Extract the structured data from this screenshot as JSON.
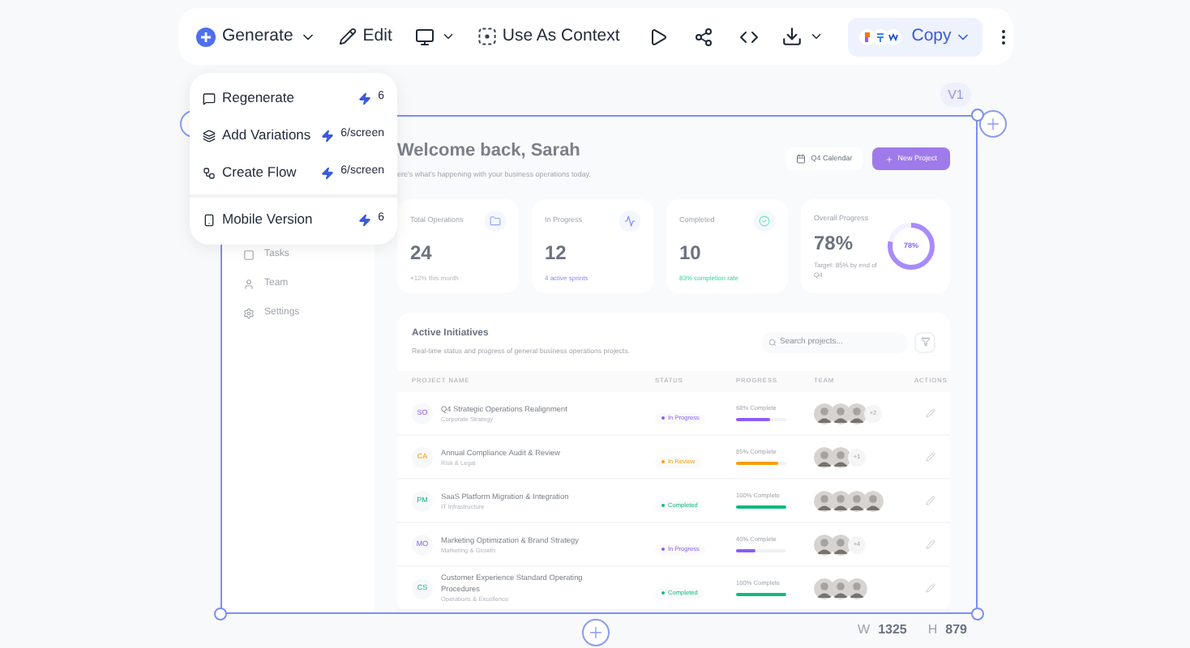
{
  "toolbar": {
    "generate_label": "Generate",
    "edit_label": "Edit",
    "context_label": "Use As Context",
    "copy_label": "Copy"
  },
  "menu": {
    "groups": [
      [
        {
          "label": "Regenerate",
          "cost": "6"
        },
        {
          "label": "Add Variations",
          "cost": "6/screen"
        },
        {
          "label": "Create Flow",
          "cost": "6/screen"
        }
      ],
      [
        {
          "label": "Mobile Version",
          "cost": "6"
        }
      ]
    ]
  },
  "canvas": {
    "version_badge": "V1",
    "width_label": "W",
    "width_value": "1325",
    "height_label": "H",
    "height_value": "879"
  },
  "design": {
    "sidebar": [
      {
        "label": "Tasks"
      },
      {
        "label": "Team"
      },
      {
        "label": "Settings"
      }
    ],
    "title": "Welcome back, Sarah",
    "subtitle": "ere's what's happening with your business operations today.",
    "calendar_button": "Q4 Calendar",
    "new_button": "New Project",
    "stats": [
      {
        "kind": "stat",
        "label": "Total Operations",
        "value": "24",
        "note": "+12% this month"
      },
      {
        "kind": "stat",
        "label": "In Progress",
        "value": "12",
        "note": "4 active sprints"
      },
      {
        "kind": "stat",
        "label": "Completed",
        "value": "10",
        "note": "83% completion rate"
      },
      {
        "kind": "ring",
        "label": "Overall Progress",
        "value": "78%",
        "note": "Target: 85% by end of Q4",
        "ring_label": "78%",
        "level": 0.78
      }
    ],
    "table": {
      "title": "Active Initiatives",
      "subtitle": "Real-time status and progress of general business operations projects.",
      "search_placeholder": "Search projects...",
      "columns": [
        "PROJECT NAME",
        "STATUS",
        "PROGRESS",
        "TEAM",
        "ACTIONS"
      ],
      "rows": [
        {
          "initials": "SO",
          "name": "Q4 Strategic Operations Realignment",
          "category": "Corporate Strategy",
          "status": {
            "label": "In Progress",
            "color": "#8b5cf6"
          },
          "progress": "68% Complete",
          "level": 0.68,
          "team": [
            {
              "kind": "person"
            },
            {
              "kind": "person"
            },
            {
              "kind": "person"
            }
          ],
          "more": "+2"
        },
        {
          "initials": "CA",
          "name": "Annual Compliance Audit & Review",
          "category": "Risk & Legal",
          "status": {
            "label": "In Review",
            "color": "#f59e0b"
          },
          "progress": "85% Complete",
          "level": 0.85,
          "team": [
            {
              "kind": "person"
            },
            {
              "kind": "person"
            }
          ],
          "more": "+1"
        },
        {
          "initials": "PM",
          "name": "SaaS Platform Migration & Integration",
          "category": "IT Infrastructure",
          "status": {
            "label": "Completed",
            "color": "#10b981"
          },
          "progress": "100% Complete",
          "level": 1,
          "team": [
            {
              "kind": "person"
            },
            {
              "kind": "person"
            },
            {
              "kind": "person"
            },
            {
              "kind": "person"
            }
          ]
        },
        {
          "initials": "MO",
          "name": "Marketing Optimization & Brand Strategy",
          "category": "Marketing & Growth",
          "status": {
            "label": "In Progress",
            "color": "#8b5cf6"
          },
          "progress": "40% Complete",
          "level": 0.4,
          "team": [
            {
              "kind": "person"
            },
            {
              "kind": "person"
            }
          ],
          "more": "+4"
        },
        {
          "initials": "CS",
          "name": "Customer Experience Standard Operating Procedures",
          "category": "Operations & Excellence",
          "status": {
            "label": "Completed",
            "color": "#10b981"
          },
          "progress": "100% Complete",
          "level": 1,
          "team": [
            {
              "kind": "person"
            },
            {
              "kind": "person"
            },
            {
              "kind": "person"
            }
          ]
        }
      ]
    }
  }
}
